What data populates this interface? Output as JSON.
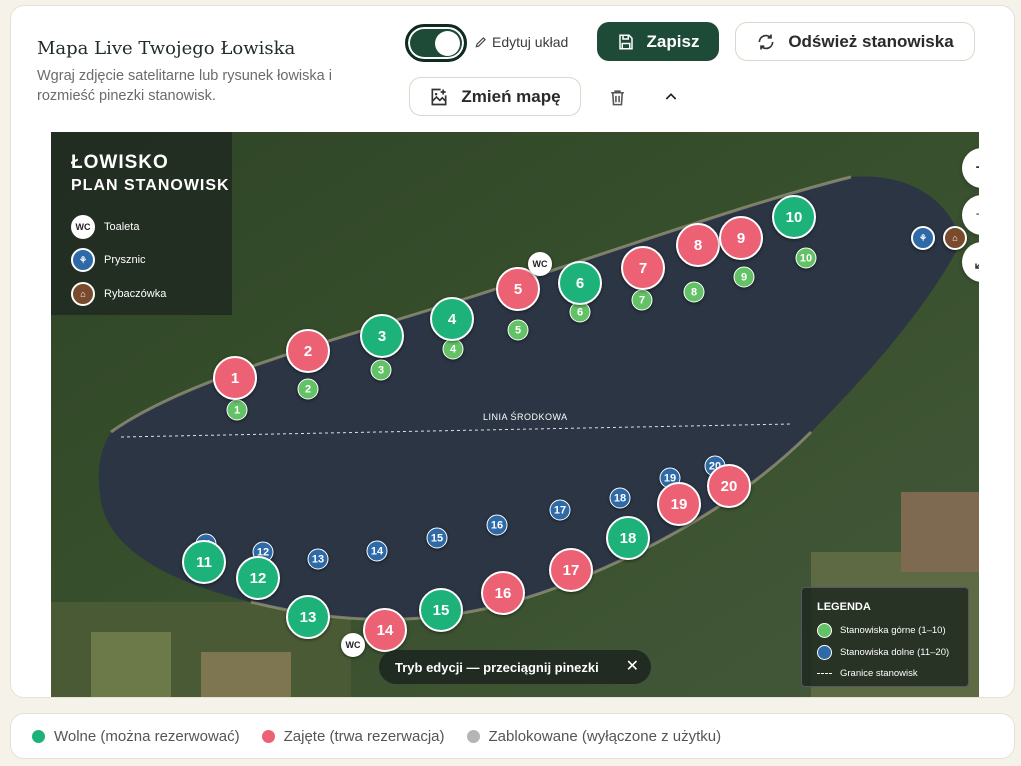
{
  "header": {
    "title": "Mapa Live Twojego Łowiska",
    "subtitle": "Wgraj zdjęcie satelitarne lub rysunek łowiska i rozmieść pinezki stanowisk.",
    "edit_toggle_on": true,
    "edit_layout_label": "Edytuj układ",
    "save_label": "Zapisz",
    "refresh_label": "Odśwież stanowiska",
    "change_map_label": "Zmień mapę"
  },
  "map_legend": {
    "title_line1": "ŁOWISKO",
    "title_line2": "PLAN STANOWISK",
    "items": [
      {
        "icon": "WC",
        "label": "Toaleta"
      },
      {
        "icon": "shower-icon",
        "label": "Prysznic"
      },
      {
        "icon": "house-icon",
        "label": "Rybaczówka"
      }
    ]
  },
  "map_legend2": {
    "title": "LEGENDA",
    "upper": "Stanowiska górne (1–10)",
    "lower": "Stanowiska dolne (11–20)",
    "bounds": "Granice stanowisk"
  },
  "midline_label": "LINIA ŚRODKOWA",
  "wc_label": "WC",
  "toast": "Tryb edycji — przeciągnij pinezki",
  "colors": {
    "free": "#1cb27a",
    "busy": "#ec6173",
    "blocked": "#b5b5b5",
    "upper": "#62c265",
    "lower": "#2f6aa8",
    "dark": "#1e4a38"
  },
  "pins": [
    {
      "n": "1",
      "status": "busy"
    },
    {
      "n": "2",
      "status": "busy"
    },
    {
      "n": "3",
      "status": "free"
    },
    {
      "n": "4",
      "status": "free"
    },
    {
      "n": "5",
      "status": "busy"
    },
    {
      "n": "6",
      "status": "free"
    },
    {
      "n": "7",
      "status": "busy"
    },
    {
      "n": "8",
      "status": "busy"
    },
    {
      "n": "9",
      "status": "busy"
    },
    {
      "n": "10",
      "status": "free"
    },
    {
      "n": "11",
      "status": "free"
    },
    {
      "n": "12",
      "status": "free"
    },
    {
      "n": "13",
      "status": "free"
    },
    {
      "n": "14",
      "status": "busy"
    },
    {
      "n": "15",
      "status": "free"
    },
    {
      "n": "16",
      "status": "busy"
    },
    {
      "n": "17",
      "status": "busy"
    },
    {
      "n": "18",
      "status": "free"
    },
    {
      "n": "19",
      "status": "busy"
    },
    {
      "n": "20",
      "status": "busy"
    }
  ],
  "status_legend": [
    {
      "label": "Wolne (można rezerwować)",
      "color": "#1cb27a"
    },
    {
      "label": "Zajęte (trwa rezerwacja)",
      "color": "#ec6173"
    },
    {
      "label": "Zablokowane (wyłączone z użytku)",
      "color": "#b5b5b5"
    }
  ]
}
